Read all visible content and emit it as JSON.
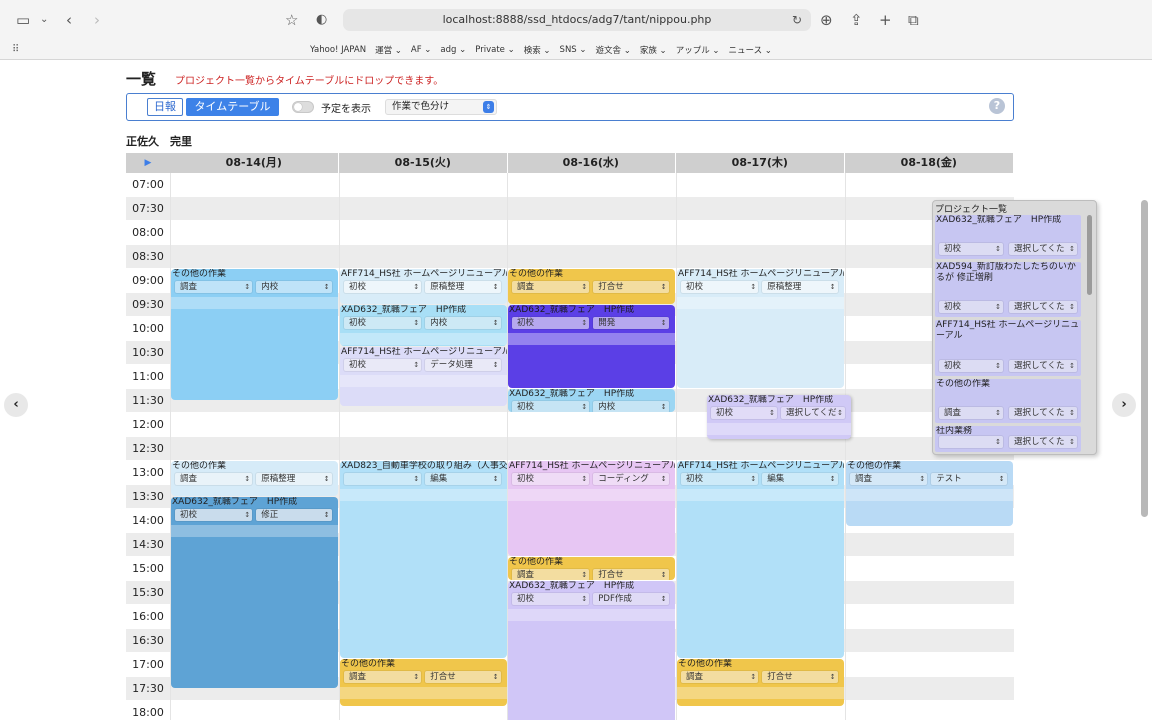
{
  "browser": {
    "url": "localhost:8888/ssd_htdocs/adg7/tant/nippou.php",
    "bookmarks": [
      "Yahoo! JAPAN",
      "運営 ⌄",
      "AF ⌄",
      "adg ⌄",
      "Private ⌄",
      "検索 ⌄",
      "SNS ⌄",
      "遊文舎 ⌄",
      "家族 ⌄",
      "アップル ⌄",
      "ニュース ⌄"
    ]
  },
  "page": {
    "title": "一覧",
    "hint": "プロジェクト一覧からタイムテーブルにドロップできます。",
    "user": "正佐久　完里"
  },
  "controls": {
    "tab_daily": "日報",
    "tab_timetable": "タイムテーブル",
    "toggle_label": "予定を表示",
    "color_select": "作業で色分け",
    "help": "?"
  },
  "days": [
    "08-14(月)",
    "08-15(火)",
    "08-16(水)",
    "08-17(木)",
    "08-18(金)"
  ],
  "times": [
    "07:00",
    "07:30",
    "08:00",
    "08:30",
    "09:00",
    "09:30",
    "10:00",
    "10:30",
    "11:00",
    "11:30",
    "12:00",
    "12:30",
    "13:00",
    "13:30",
    "14:00",
    "14:30",
    "15:00",
    "15:30",
    "16:00",
    "16:30",
    "17:00",
    "17:30",
    "18:00"
  ],
  "events": [
    {
      "day": 0,
      "start": 4,
      "end": 9.5,
      "title": "その他の作業",
      "a": "調査",
      "b": "内校",
      "color": "#8ccff4",
      "sel": "#bfe3f8"
    },
    {
      "day": 0,
      "start": 12,
      "end": 13.5,
      "title": "その他の作業",
      "a": "調査",
      "b": "原稿整理",
      "color": "#d6ebf8",
      "sel": "#e9f3f9"
    },
    {
      "day": 0,
      "start": 13.5,
      "end": 21.5,
      "title": "XAD632_就職フェア　HP作成",
      "a": "初校",
      "b": "修正",
      "color": "#5ea3d5",
      "sel": "#c9dcec"
    },
    {
      "day": 1,
      "start": 4,
      "end": 5.5,
      "title": "AFF714_HS社 ホームページリニューアル",
      "a": "初校",
      "b": "原稿整理",
      "color": "#d8ecf8",
      "sel": "#eef6fb"
    },
    {
      "day": 1,
      "start": 5.5,
      "end": 7.25,
      "title": "XAD632_就職フェア　HP作成",
      "a": "初校",
      "b": "内校",
      "color": "#a8dff6",
      "sel": "#cde9f5"
    },
    {
      "day": 1,
      "start": 7.25,
      "end": 9.75,
      "title": "AFF714_HS社 ホームページリニューアル",
      "a": "初校",
      "b": "データ処理",
      "color": "#dcdcf8",
      "sel": "#e9e9f7"
    },
    {
      "day": 1,
      "start": 12,
      "end": 20.25,
      "title": "XAD823_自動車学校の取り組み（人事交流）",
      "a": "",
      "b": "編集",
      "color": "#b1e0f8",
      "sel": "#cdeaf8"
    },
    {
      "day": 1,
      "start": 20.25,
      "end": 22.25,
      "title": "その他の作業",
      "a": "調査",
      "b": "打合せ",
      "color": "#f0c64b",
      "sel": "#f3dda0"
    },
    {
      "day": 2,
      "start": 4,
      "end": 5.5,
      "title": "その他の作業",
      "a": "調査",
      "b": "打合せ",
      "color": "#f0c64b",
      "sel": "#f3dda0"
    },
    {
      "day": 2,
      "start": 5.5,
      "end": 9,
      "title": "XAD632_就職フェア　HP作成",
      "a": "初校",
      "b": "開発",
      "color": "#5b3fe6",
      "sel": "#b6a8ee"
    },
    {
      "day": 2,
      "start": 9,
      "end": 10,
      "title": "XAD632_就職フェア　HP作成",
      "a": "初校",
      "b": "内校",
      "color": "#9cd6f3",
      "sel": "#c6e4f4"
    },
    {
      "day": 2,
      "start": 12,
      "end": 16,
      "title": "AFF714_HS社 ホームページリニューアル",
      "a": "初校",
      "b": "コーディング",
      "color": "#e7c6f3",
      "sel": "#efdcf6"
    },
    {
      "day": 2,
      "start": 16,
      "end": 17,
      "title": "その他の作業",
      "a": "調査",
      "b": "打合せ",
      "color": "#f0c64b",
      "sel": "#f3dda0"
    },
    {
      "day": 2,
      "start": 17,
      "end": 23,
      "title": "XAD632_就職フェア　HP作成",
      "a": "初校",
      "b": "PDF作成",
      "color": "#d0c6f7",
      "sel": "#e0dbf6"
    },
    {
      "day": 3,
      "start": 4,
      "end": 9,
      "title": "AFF714_HS社 ホームページリニューアル",
      "a": "初校",
      "b": "原稿整理",
      "color": "#d8ecf8",
      "sel": "#eef6fb"
    },
    {
      "day": 3,
      "start": 12,
      "end": 20.25,
      "title": "AFF714_HS社 ホームページリニューアル",
      "a": "初校",
      "b": "編集",
      "color": "#b1e0f8",
      "sel": "#cdeaf8"
    },
    {
      "day": 3,
      "start": 20.25,
      "end": 22.25,
      "title": "その他の作業",
      "a": "調査",
      "b": "打合せ",
      "color": "#f0c64b",
      "sel": "#f3dda0"
    },
    {
      "day": 4,
      "start": 12,
      "end": 14.75,
      "title": "その他の作業",
      "a": "調査",
      "b": "テスト",
      "color": "#b9daf5",
      "sel": "#d5e8f7"
    }
  ],
  "floating_event": {
    "title": "XAD632_就職フェア　HP作成",
    "a": "初校",
    "b": "選択してくだ",
    "color": "#d0c9f6",
    "sel": "#e1dcf7"
  },
  "project_list": {
    "title": "プロジェクト一覧",
    "items": [
      {
        "title": "XAD632_就職フェア　HP作成",
        "a": "初校",
        "b": "選択してくた"
      },
      {
        "title": "XAD594_新訂版わたしたちのいかるが 修正増刷",
        "a": "初校",
        "b": "選択してくた"
      },
      {
        "title": "AFF714_HS社 ホームページリニューアル",
        "a": "初校",
        "b": "選択してくた"
      },
      {
        "title": "その他の作業",
        "a": "調査",
        "b": "選択してくた"
      },
      {
        "title": "社内業務",
        "a": "",
        "b": "選択してくた"
      }
    ]
  }
}
